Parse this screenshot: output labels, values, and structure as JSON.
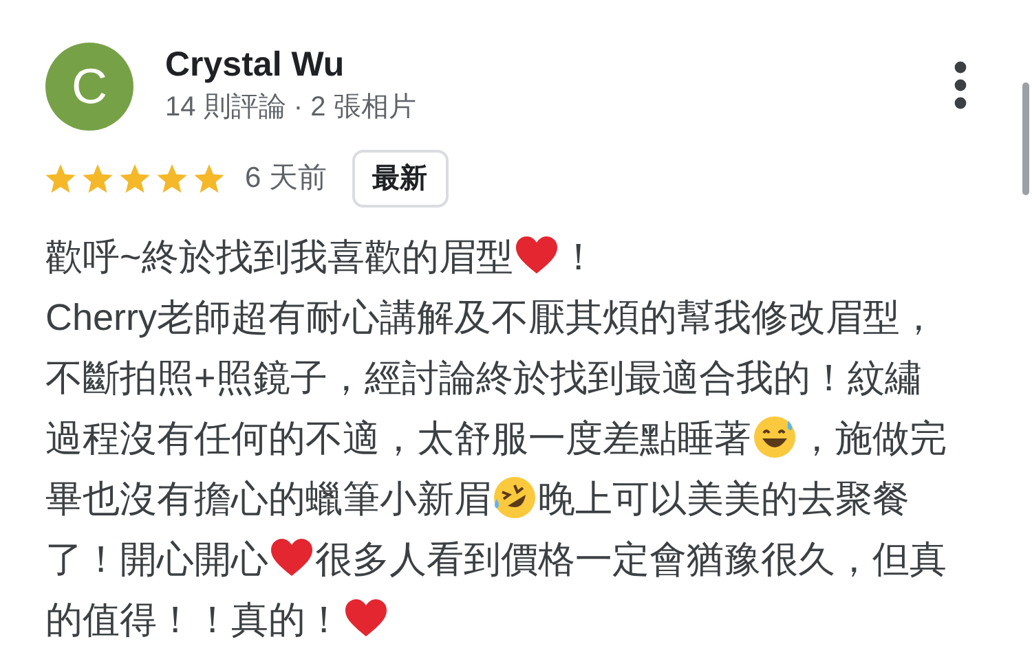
{
  "reviewer": {
    "initial": "C",
    "name": "Crystal Wu",
    "stats": "14 則評論 · 2 張相片"
  },
  "rating": {
    "stars": 5,
    "time": "6 天前",
    "badge": "最新"
  },
  "body_lines": [
    [
      {
        "kind": "text",
        "text": "歡呼~終於找到我喜歡的眉型"
      },
      {
        "kind": "heart"
      },
      {
        "kind": "text",
        "text": "！"
      }
    ],
    [
      {
        "kind": "text",
        "text": "Cherry老師超有耐心講解及不厭其煩的幫我修改眉型，"
      }
    ],
    [
      {
        "kind": "text",
        "text": "不斷拍照+照鏡子，經討論終於找到最適合我的！紋繡"
      }
    ],
    [
      {
        "kind": "text",
        "text": "過程沒有任何的不適，太舒服一度差點睡著"
      },
      {
        "kind": "sweat-smile"
      },
      {
        "kind": "text",
        "text": "，施做完"
      }
    ],
    [
      {
        "kind": "text",
        "text": "畢也沒有擔心的蠟筆小新眉"
      },
      {
        "kind": "laughing-tears"
      },
      {
        "kind": "text",
        "text": "晚上可以美美的去聚餐"
      }
    ],
    [
      {
        "kind": "text",
        "text": "了！開心開心"
      },
      {
        "kind": "heart"
      },
      {
        "kind": "text",
        "text": "很多人看到價格一定會猶豫很久，但真"
      }
    ],
    [
      {
        "kind": "text",
        "text": "的值得！！真的！"
      },
      {
        "kind": "heart"
      }
    ]
  ]
}
